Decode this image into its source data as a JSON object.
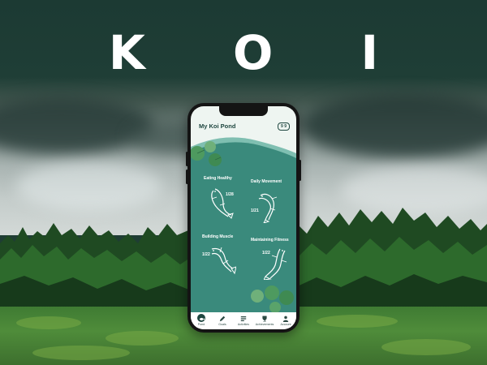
{
  "hero": {
    "title": "K O I"
  },
  "app": {
    "header_title": "My Koi Pond",
    "header_badge": "9 9",
    "goals": [
      {
        "title": "Eating Healthy",
        "count": "1/28"
      },
      {
        "title": "Daily Movement",
        "count": "1/21"
      },
      {
        "title": "Building Muscle",
        "count": "1/22"
      },
      {
        "title": "Maintaining Fitness",
        "count": "1/22"
      }
    ],
    "tabs": [
      {
        "label": "Pond",
        "icon": "koi-icon",
        "active": true
      },
      {
        "label": "Goals",
        "icon": "pencil-icon",
        "active": false
      },
      {
        "label": "Activities",
        "icon": "list-icon",
        "active": false
      },
      {
        "label": "Achievements",
        "icon": "trophy-icon",
        "active": false
      },
      {
        "label": "Account",
        "icon": "user-icon",
        "active": false
      }
    ]
  },
  "colors": {
    "pond_teal": "#3a8a7c",
    "dark_green": "#1f4740",
    "lily_green": "#4e9a5f",
    "screen_bg": "#eef5f1"
  }
}
